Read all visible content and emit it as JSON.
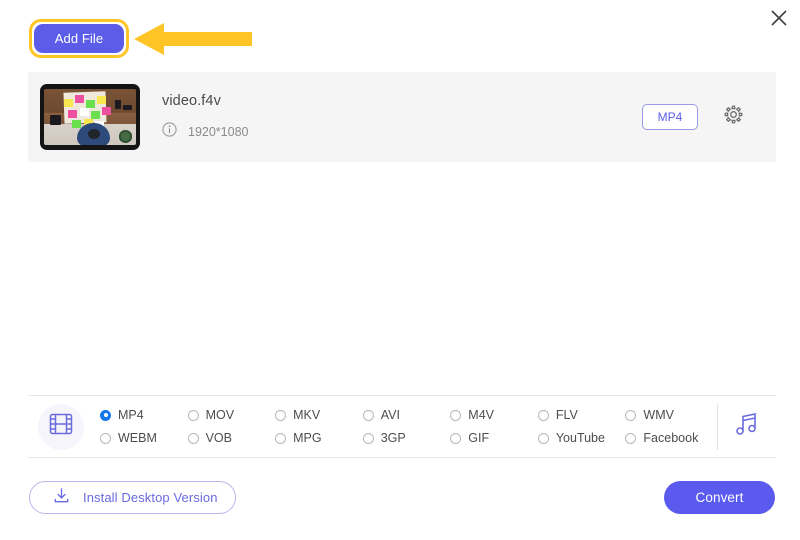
{
  "window": {
    "close_icon": "close-icon"
  },
  "toolbar": {
    "add_file_label": "Add File",
    "highlight_color": "#FFC425",
    "button_color": "#5b5ce8",
    "arrow_icon": "left-arrow-annotation",
    "arrow_color": "#FFC425"
  },
  "file_list": [
    {
      "thumbnail_icon": "video-thumbnail",
      "name": "video.f4v",
      "info_icon": "info-icon",
      "resolution": "1920*1080",
      "output_format_badge": "MP4",
      "settings_icon": "gear-icon"
    }
  ],
  "format_panel": {
    "video_icon": "film-strip-icon",
    "audio_icon": "music-note-icon",
    "selected": "MP4",
    "accent_color": "#1577e8",
    "options_row1": [
      "MP4",
      "MOV",
      "MKV",
      "AVI",
      "M4V",
      "FLV",
      "WMV"
    ],
    "options_row2": [
      "WEBM",
      "VOB",
      "MPG",
      "3GP",
      "GIF",
      "YouTube",
      "Facebook"
    ]
  },
  "footer": {
    "install_label": "Install Desktop Version",
    "install_icon": "download-icon",
    "convert_label": "Convert",
    "convert_color": "#5a5aee"
  }
}
